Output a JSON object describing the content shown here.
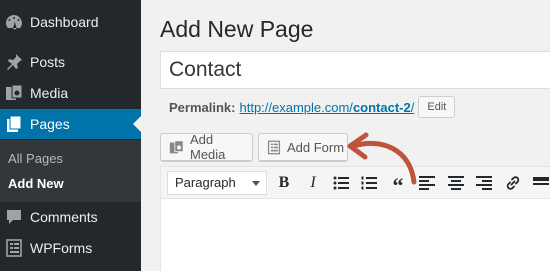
{
  "sidebar": {
    "items": [
      {
        "label": "Dashboard",
        "icon": "dashboard-icon"
      },
      {
        "label": "Posts",
        "icon": "pushpin-icon"
      },
      {
        "label": "Media",
        "icon": "media-icon"
      },
      {
        "label": "Pages",
        "icon": "pages-icon"
      },
      {
        "label": "Comments",
        "icon": "comment-icon"
      },
      {
        "label": "WPForms",
        "icon": "wpforms-icon"
      }
    ],
    "submenu": [
      {
        "label": "All Pages"
      },
      {
        "label": "Add New"
      }
    ],
    "active_color": "#0073aa"
  },
  "main": {
    "title": "Add New Page",
    "title_input_value": "Contact",
    "permalink": {
      "label": "Permalink:",
      "url_prefix": "http://example.com/",
      "slug": "contact-2",
      "url_suffix": "/",
      "edit_label": "Edit"
    },
    "buttons": {
      "add_media": "Add Media",
      "add_form": "Add Form"
    },
    "toolbar": {
      "format": "Paragraph",
      "bold": "B",
      "italic": "I",
      "quote": "“"
    }
  },
  "annotation": {
    "arrow_color": "#c0533b"
  }
}
